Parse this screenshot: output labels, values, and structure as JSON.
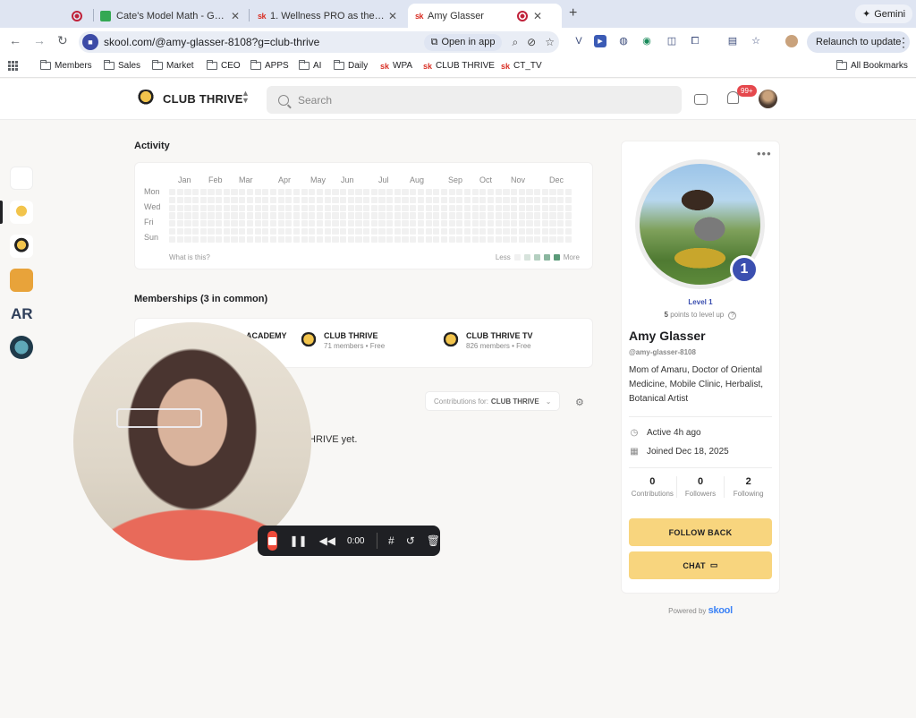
{
  "browser": {
    "tabs": [
      {
        "title": "",
        "icon": "record-icon"
      },
      {
        "title": "Cate's Model Math - Google",
        "icon": "sheets-icon"
      },
      {
        "title": "1. Wellness PRO as the HERO",
        "icon": "skool-icon"
      },
      {
        "title": "Amy Glasser",
        "icon": "skool-icon"
      }
    ],
    "skool_favicon": "sk",
    "gemini_label": "Gemini",
    "url": "skool.com/@amy-glasser-8108?g=club-thrive",
    "open_in_app": "Open in app",
    "relaunch_label": "Relaunch to update",
    "bookmarks": [
      "Members",
      "Sales",
      "Market",
      "CEO",
      "APPS",
      "AI",
      "Daily",
      "WPA",
      "CLUB THRIVE",
      "CT_TV"
    ],
    "all_bookmarks": "All Bookmarks"
  },
  "header": {
    "community_name": "CLUB THRIVE",
    "search_placeholder": "Search",
    "notification_count": "99+"
  },
  "rail": {
    "ar_label": "AR"
  },
  "activity": {
    "title": "Activity",
    "months": [
      "Jan",
      "Feb",
      "Mar",
      "Apr",
      "May",
      "Jun",
      "Jul",
      "Aug",
      "Sep",
      "Oct",
      "Nov",
      "Dec"
    ],
    "days": [
      "Mon",
      "Wed",
      "Fri",
      "Sun"
    ],
    "what_is_this": "What is this?",
    "less": "Less",
    "more": "More"
  },
  "memberships": {
    "title": "Memberships (3 in common)",
    "items": [
      {
        "name": "ACADEMY",
        "sub": ""
      },
      {
        "name": "CLUB THRIVE",
        "sub": "71 members • Free"
      },
      {
        "name": "CLUB THRIVE TV",
        "sub": "826 members • Free"
      }
    ]
  },
  "contributions": {
    "prefix": "Contributions for:",
    "community": "CLUB THRIVE",
    "empty_tail": "HRIVE yet."
  },
  "profile": {
    "level_number": "1",
    "level_label": "Level 1",
    "points": "5",
    "points_suffix": "points to level up",
    "name": "Amy Glasser",
    "handle": "@amy-glasser-8108",
    "bio": "Mom of Amaru, Doctor of Oriental Medicine, Mobile Clinic, Herbalist, Botanical Artist",
    "active": "Active 4h ago",
    "joined": "Joined Dec 18, 2025",
    "stats": [
      {
        "value": "0",
        "label": "Contributions"
      },
      {
        "value": "0",
        "label": "Followers"
      },
      {
        "value": "2",
        "label": "Following"
      }
    ],
    "follow_back": "FOLLOW BACK",
    "chat": "CHAT"
  },
  "footer": {
    "powered_by": "Powered by",
    "brand": "skool"
  },
  "recorder": {
    "time": "0:00"
  },
  "colors": {
    "accent_yellow": "#f8d57e",
    "level_blue": "#3b4fb0",
    "record_red": "#ef4a3a",
    "notification_red": "#e5484d"
  }
}
